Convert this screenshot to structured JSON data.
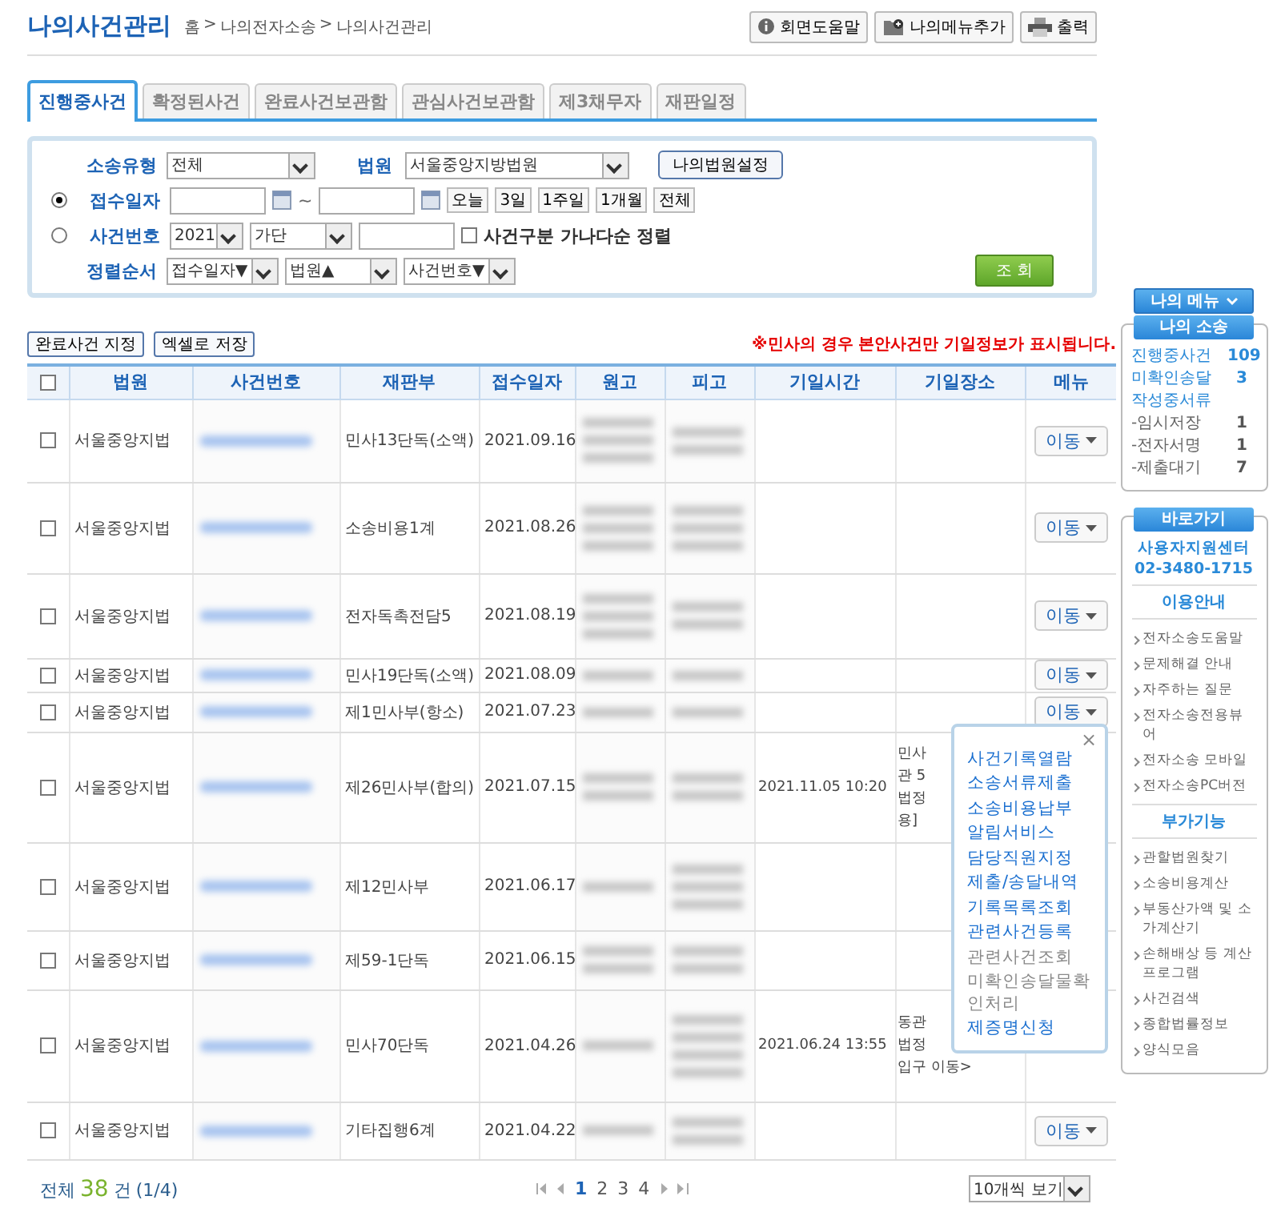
{
  "header": {
    "title": "나의사건관리",
    "breadcrumb": [
      "홈",
      ">",
      "나의전자소송",
      ">",
      "나의사건관리"
    ],
    "buttons": [
      {
        "kind": "help",
        "label": "회면도움말"
      },
      {
        "kind": "addmenu",
        "label": "나의메뉴추가"
      },
      {
        "kind": "print",
        "label": "출력"
      }
    ]
  },
  "tabs": [
    {
      "label": "진행중사건",
      "selected": true
    },
    {
      "label": "확정된사건",
      "selected": false
    },
    {
      "label": "완료사건보관함",
      "selected": false
    },
    {
      "label": "관심사건보관함",
      "selected": false
    },
    {
      "label": "제3채무자",
      "selected": false
    },
    {
      "label": "재판일정",
      "selected": false
    }
  ],
  "search": {
    "type_label": "소송유형",
    "type_value": "전체",
    "court_label": "법원",
    "court_value": "서울중앙지방법원",
    "court_button": "나의법원설정",
    "date_mode": {
      "label": "접수일자",
      "selected": true
    },
    "tilde": "~",
    "date_buttons": [
      "오늘",
      "3일",
      "1주일",
      "1개월",
      "전체"
    ],
    "case_mode": {
      "label": "사건번호",
      "selected": false
    },
    "year": "2021",
    "case_type": "가단",
    "sort_check": {
      "label": "사건구분 가나다순 정렬",
      "checked": false
    },
    "order_label": "정렬순서",
    "orders": [
      "접수일자▼",
      "법원▲",
      "사건번호▼"
    ],
    "submit": "조 회"
  },
  "actions": [
    "완료사건 지정",
    "엑셀로 저장"
  ],
  "notice": "※민사의 경우 본안사건만 기일정보가 표시됩니다.",
  "table": {
    "select_all_checked": false,
    "columns": [
      "법원",
      "사건번호",
      "재판부",
      "접수일자",
      "원고",
      "피고",
      "기일시간",
      "기일장소",
      "메뉴"
    ],
    "rows": [
      {
        "checked": false,
        "court": "서울중앙지법",
        "division": "민사13단독(소액)",
        "date": "2021.09.16",
        "move": "이동"
      },
      {
        "checked": false,
        "court": "서울중앙지법",
        "division": "소송비용1계",
        "date": "2021.08.26",
        "move": "이동"
      },
      {
        "checked": false,
        "court": "서울중앙지법",
        "division": "전자독촉전담5",
        "date": "2021.08.19",
        "move": "이동"
      },
      {
        "checked": false,
        "court": "서울중앙지법",
        "division": "민사19단독(소액)",
        "date": "2021.08.09",
        "move": "이동"
      },
      {
        "checked": false,
        "court": "서울중앙지법",
        "division": "제1민사부(항소)",
        "date": "2021.07.23",
        "move": "이동"
      },
      {
        "checked": false,
        "court": "서울중앙지법",
        "division": "제26민사부(합의)",
        "date": "2021.07.15",
        "hearing_time": "2021.11.05 10:20",
        "hearing_place": [
          "민사",
          "관 5",
          "법정",
          "용]"
        ]
      },
      {
        "checked": false,
        "court": "서울중앙지법",
        "division": "제12민사부",
        "date": "2021.06.17"
      },
      {
        "checked": false,
        "court": "서울중앙지법",
        "division": "제59-1단독",
        "date": "2021.06.15"
      },
      {
        "checked": false,
        "court": "서울중앙지법",
        "division": "민사70단독",
        "date": "2021.04.26",
        "hearing_time": "2021.06.24 13:55",
        "hearing_place": [
          "동관",
          "법정",
          "입구 이동>"
        ]
      },
      {
        "checked": false,
        "court": "서울중앙지법",
        "division": "기타집행6계",
        "date": "2021.04.22",
        "move": "이동"
      }
    ]
  },
  "popup": {
    "close": "×",
    "items": [
      {
        "label": "사건기록열람",
        "enabled": true
      },
      {
        "label": "소송서류제출",
        "enabled": true
      },
      {
        "label": "소송비용납부",
        "enabled": true
      },
      {
        "label": "알림서비스",
        "enabled": true
      },
      {
        "label": "담당직원지정",
        "enabled": true
      },
      {
        "label": "제출/송달내역",
        "enabled": true
      },
      {
        "label": "기록목록조회",
        "enabled": true
      },
      {
        "label": "관련사건등록",
        "enabled": true
      },
      {
        "label": "관련사건조회",
        "enabled": false
      },
      {
        "label": "미확인송달물확인처리",
        "enabled": false
      },
      {
        "label": "제증명신청",
        "enabled": true
      }
    ]
  },
  "footer": {
    "total_prefix": "전체",
    "total": "38",
    "total_suffix": "건",
    "page_info": "(1/4)",
    "pages": [
      {
        "label": "1",
        "selected": true
      },
      {
        "label": "2",
        "selected": false
      },
      {
        "label": "3",
        "selected": false
      },
      {
        "label": "4",
        "selected": false
      }
    ],
    "per_page": "10개씩 보기"
  },
  "sidebar": {
    "menu_button": "나의 메뉴",
    "my_case": {
      "title": "나의 소송",
      "items": [
        {
          "label": "진행중사건",
          "count": "109",
          "sub": false
        },
        {
          "label": "미확인송달",
          "count": "3",
          "sub": false
        },
        {
          "label": "작성중서류",
          "sub": false
        },
        {
          "label": "-임시저장",
          "count": "1",
          "sub": true
        },
        {
          "label": "-전자서명",
          "count": "1",
          "sub": true
        },
        {
          "label": "-제출대기",
          "count": "7",
          "sub": true
        }
      ]
    },
    "shortcut": {
      "title": "바로가기",
      "center": "사용자지원센터",
      "phone": "02-3480-1715",
      "sections": [
        {
          "title": "이용안내",
          "items": [
            "전자소송도움말",
            "문제해결 안내",
            "자주하는 질문",
            "전자소송전용뷰어",
            "전자소송 모바일",
            "전자소송PC버전"
          ]
        },
        {
          "title": "부가기능",
          "items": [
            "관할법원찾기",
            "소송비용계산",
            "부동산가액 및 소가계산기",
            "손해배상 등 계산 프로그램",
            "사건검색",
            "종합법률정보",
            "양식모음"
          ]
        }
      ]
    }
  }
}
